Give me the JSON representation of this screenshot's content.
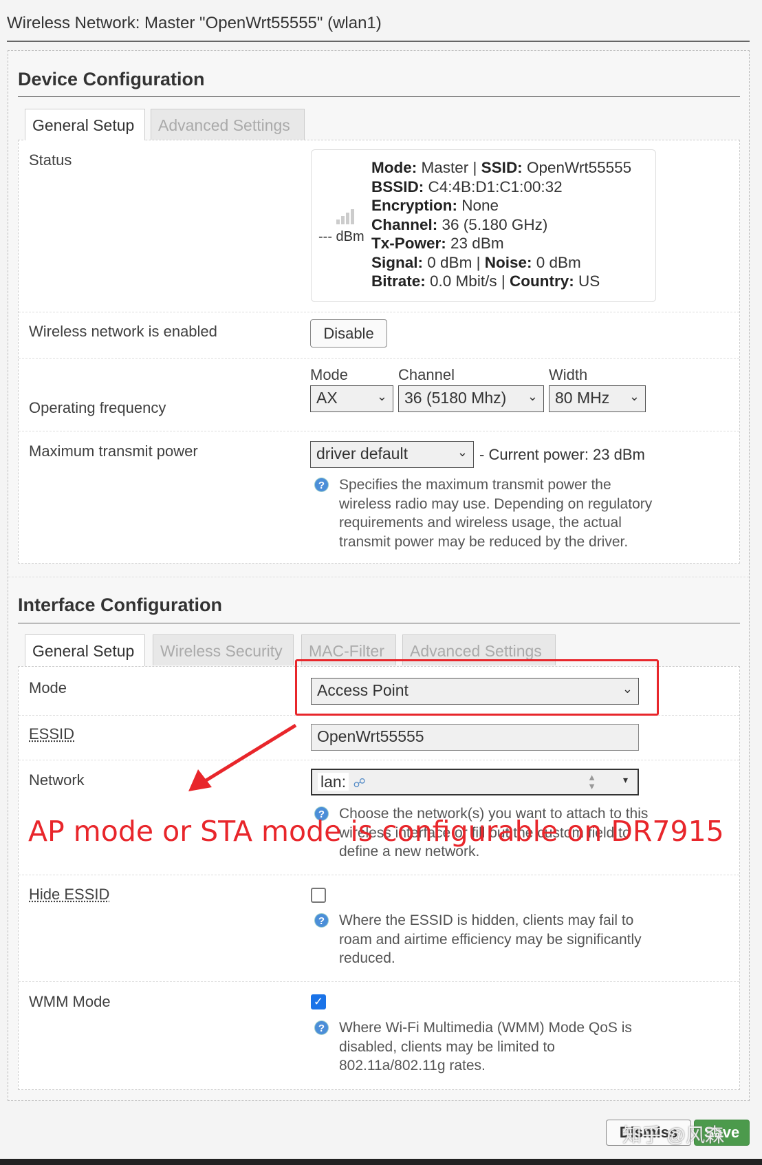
{
  "window_title": "Wireless Network: Master \"OpenWrt55555\" (wlan1)",
  "device": {
    "heading": "Device Configuration",
    "tabs": [
      "General Setup",
      "Advanced Settings"
    ],
    "status_label": "Status",
    "signal_text": "--- dBm",
    "status": {
      "mode_k": "Mode:",
      "mode": "Master",
      "ssid_k": "SSID:",
      "ssid": "OpenWrt55555",
      "bssid_k": "BSSID:",
      "bssid": "C4:4B:D1:C1:00:32",
      "enc_k": "Encryption:",
      "enc": "None",
      "chan_k": "Channel:",
      "chan": "36 (5.180 GHz)",
      "tx_k": "Tx-Power:",
      "tx": "23 dBm",
      "sig_k": "Signal:",
      "sig": "0 dBm",
      "noise_k": "Noise:",
      "noise": "0 dBm",
      "bitrate_k": "Bitrate:",
      "bitrate": "0.0 Mbit/s",
      "country_k": "Country:",
      "country": "US",
      "sep": "|"
    },
    "enabled_label": "Wireless network is enabled",
    "disable_button": "Disable",
    "freq_label": "Operating frequency",
    "mode_label": "Mode",
    "mode_value": "AX",
    "channel_label": "Channel",
    "channel_value": "36 (5180 Mhz)",
    "width_label": "Width",
    "width_value": "80 MHz",
    "txpower_label": "Maximum transmit power",
    "txpower_value": "driver default",
    "current_power": "- Current power: 23 dBm",
    "txpower_help": [
      "Specifies the maximum transmit power the",
      "wireless radio may use. Depending on regulatory",
      "requirements and wireless usage, the actual",
      "transmit power may be reduced by the driver."
    ]
  },
  "iface": {
    "heading": "Interface Configuration",
    "tabs": [
      "General Setup",
      "Wireless Security",
      "MAC-Filter",
      "Advanced Settings"
    ],
    "mode_label": "Mode",
    "mode_value": "Access Point",
    "essid_label": "ESSID",
    "essid_value": "OpenWrt55555",
    "network_label": "Network",
    "network_value": "lan:",
    "network_help": [
      "Choose the network(s) you want to attach to this",
      "wireless interface or fill out the custom field to",
      "define a new network."
    ],
    "hide_label": "Hide ESSID",
    "hide_checked": false,
    "hide_help": [
      "Where the ESSID is hidden, clients may fail to",
      "roam and airtime efficiency may be significantly",
      "reduced."
    ],
    "wmm_label": "WMM Mode",
    "wmm_checked": true,
    "wmm_help": [
      "Where Wi-Fi Multimedia (WMM) Mode QoS is",
      "disabled, clients may be limited to",
      "802.11a/802.11g rates."
    ]
  },
  "annotation": "AP mode or STA mode is configurable on DR7915",
  "annotation_color": "#e8262b",
  "footer": {
    "dismiss": "Dismiss",
    "save": "Save"
  },
  "watermark": "知乎 @风森"
}
